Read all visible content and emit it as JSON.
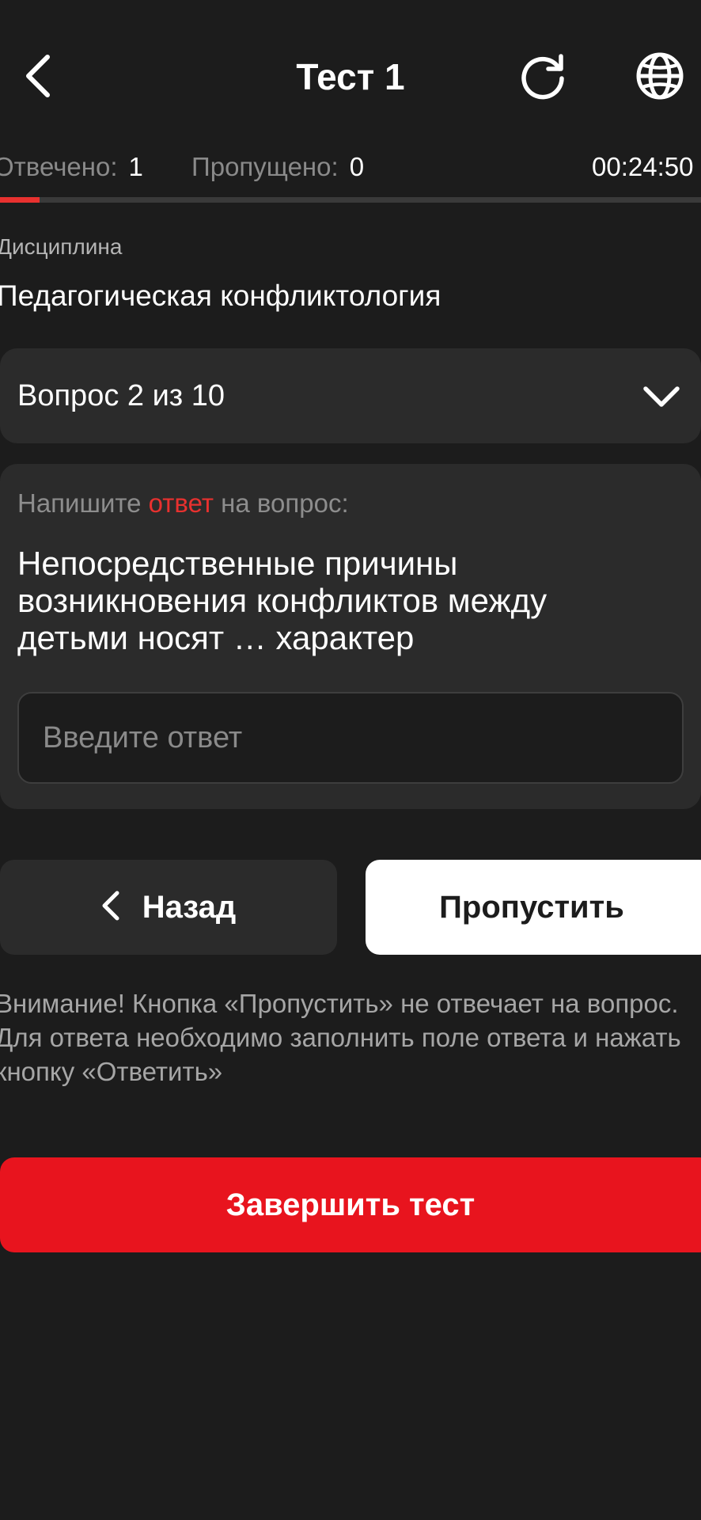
{
  "header": {
    "title": "Тест 1",
    "back_icon": "chevron-left-icon",
    "refresh_icon": "refresh-icon",
    "language_icon": "globe-icon"
  },
  "stats": {
    "answered_label": "Отвечено:",
    "answered_value": "1",
    "skipped_label": "Пропущено:",
    "skipped_value": "0",
    "timer": "00:24:50"
  },
  "progress": {
    "answered": 1,
    "total": 10,
    "fill_color": "#e8312f"
  },
  "discipline": {
    "label": "Дисциплина",
    "value": "Педагогическая конфликтология"
  },
  "question_selector": {
    "label": "Вопрос 2 из 10",
    "icon": "chevron-down-icon"
  },
  "question": {
    "instruction_before": "Напишите ",
    "instruction_accent": "ответ",
    "instruction_after": " на вопрос:",
    "text": "Непосредственные причины возникновения конфликтов между детьми носят … характер",
    "input_value": "",
    "input_placeholder": "Введите ответ"
  },
  "actions": {
    "back_label": "Назад",
    "skip_label": "Пропустить",
    "finish_label": "Завершить тест"
  },
  "warning": {
    "text": "Внимание! Кнопка «Пропустить» не отвечает на вопрос. Для ответа необходимо заполнить поле ответа и нажать кнопку «Ответить»"
  },
  "colors": {
    "background": "#1c1c1c",
    "card": "#2b2b2b",
    "accent": "#e8312f",
    "finish": "#e8141e"
  }
}
